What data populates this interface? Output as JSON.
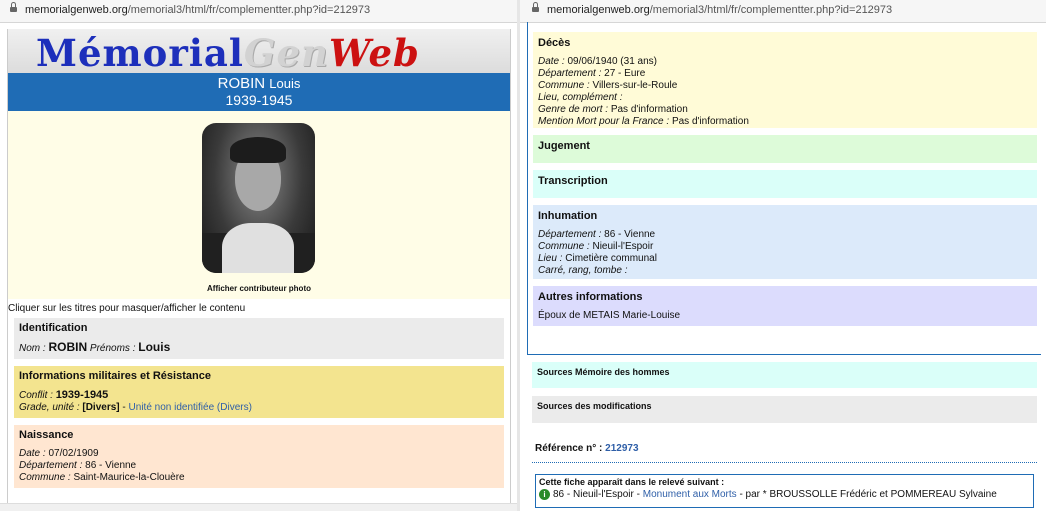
{
  "browser": {
    "left_url_domain": "memorialgenweb.org",
    "left_url_path": "/memorial3/html/fr/complementter.php?id=212973",
    "right_url_domain": "memorialgenweb.org",
    "right_url_path": "/memorial3/html/fr/complementter.php?id=212973"
  },
  "logo": {
    "part1": "Mémorial",
    "part2": "Gen",
    "part3": "Web"
  },
  "person": {
    "surname": "ROBIN",
    "firstname": "Louis",
    "years": "1939-1945",
    "photo_caption": "Afficher contributeur photo"
  },
  "hint": "Cliquer sur les titres pour masquer/afficher le contenu",
  "identification": {
    "title": "Identification",
    "nom_label": "Nom :",
    "nom": "ROBIN",
    "prenoms_label": "Prénoms :",
    "prenoms": "Louis"
  },
  "military": {
    "title": "Informations militaires et Résistance",
    "conflit_label": "Conflit :",
    "conflit": "1939-1945",
    "grade_label": "Grade, unité :",
    "grade": "[Divers]",
    "sep": "-",
    "unit": "Unité non identifiée (Divers)"
  },
  "naissance": {
    "title": "Naissance",
    "date_label": "Date :",
    "date": "07/02/1909",
    "dept_label": "Département :",
    "dept": "86 - Vienne",
    "commune_label": "Commune :",
    "commune": "Saint-Maurice-la-Clouère"
  },
  "deces": {
    "title": "Décès",
    "date_label": "Date :",
    "date": "09/06/1940  (31 ans)",
    "dept_label": "Département :",
    "dept": "27 - Eure",
    "commune_label": "Commune :",
    "commune": "Villers-sur-le-Roule",
    "lieu_label": "Lieu, complément :",
    "genre_label": "Genre de mort :",
    "genre": "Pas d'information",
    "mention_label": "Mention Mort pour la France :",
    "mention": "Pas d'information"
  },
  "jugement": {
    "title": "Jugement"
  },
  "transcription": {
    "title": "Transcription"
  },
  "inhumation": {
    "title": "Inhumation",
    "dept_label": "Département :",
    "dept": "86 - Vienne",
    "commune_label": "Commune :",
    "commune": "Nieuil-l'Espoir",
    "lieu_label": "Lieu :",
    "lieu": "Cimetière communal",
    "carre_label": "Carré, rang, tombe :"
  },
  "autres": {
    "title": "Autres informations",
    "text": "Époux de METAIS Marie-Louise"
  },
  "sources": {
    "memoire": "Sources Mémoire des hommes",
    "modifications": "Sources des modifications"
  },
  "reference": {
    "label": "Référence n° :",
    "value": "212973"
  },
  "releve": {
    "title": "Cette fiche apparaît dans le relevé suivant :",
    "icon": "info-icon",
    "place": "86 - Nieuil-l'Espoir",
    "sep": "-",
    "monument": "Monument aux Morts",
    "by": "- par * BROUSSOLLE Frédéric et POMMEREAU Sylvaine"
  }
}
